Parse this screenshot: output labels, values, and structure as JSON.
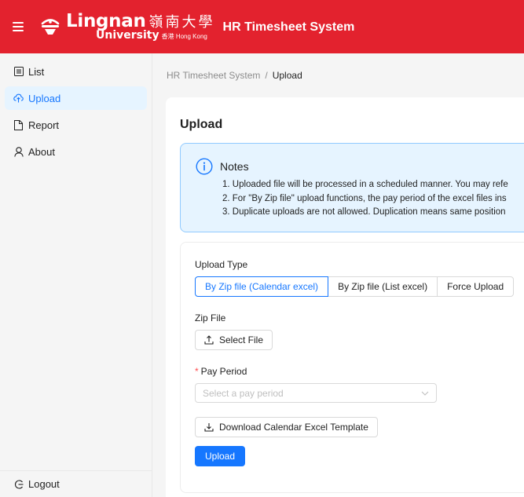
{
  "header": {
    "logo_en": "Lingnan",
    "logo_zh": "嶺南大學",
    "logo_university": "University",
    "logo_hk": "香港 Hong Kong",
    "app_title": "HR Timesheet System",
    "brand_color": "#e3222e"
  },
  "sidebar": {
    "items": [
      {
        "label": "List",
        "icon": "list-icon",
        "active": false
      },
      {
        "label": "Upload",
        "icon": "cloud-upload-icon",
        "active": true
      },
      {
        "label": "Report",
        "icon": "file-icon",
        "active": false
      },
      {
        "label": "About",
        "icon": "user-icon",
        "active": false
      }
    ],
    "logout_label": "Logout"
  },
  "breadcrumb": {
    "root": "HR Timesheet System",
    "separator": "/",
    "current": "Upload"
  },
  "page": {
    "title": "Upload"
  },
  "notes": {
    "title": "Notes",
    "lines": [
      "1. Uploaded file will be processed in a scheduled manner. You may refe",
      "2. For \"By Zip file\" upload functions, the pay period of the excel files ins",
      "3. Duplicate uploads are not allowed. Duplication means same position"
    ]
  },
  "form": {
    "upload_type_label": "Upload Type",
    "upload_types": [
      {
        "label": "By Zip file (Calendar excel)",
        "selected": true
      },
      {
        "label": "By Zip file (List excel)",
        "selected": false
      },
      {
        "label": "Force Upload",
        "selected": false
      }
    ],
    "zip_file_label": "Zip File",
    "select_file_label": "Select File",
    "pay_period_required_mark": "*",
    "pay_period_label": "Pay Period",
    "pay_period_placeholder": "Select a pay period",
    "download_template_label": "Download Calendar Excel Template",
    "upload_button_label": "Upload"
  },
  "colors": {
    "accent": "#1677ff",
    "notes_bg": "#e6f4ff",
    "notes_border": "#91caff"
  }
}
